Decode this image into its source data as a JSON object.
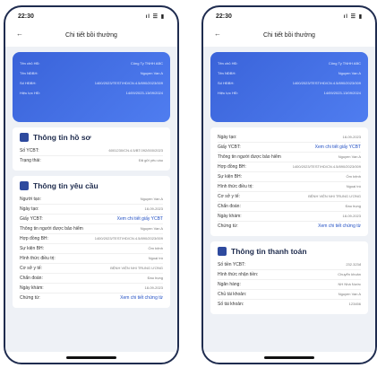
{
  "status": {
    "time": "22:30",
    "icons": "ıl ☰ ▮"
  },
  "appbar": {
    "title": "Chi tiết bồi thường"
  },
  "hero": [
    {
      "label": "Tên chủ HĐ:",
      "value": "Công Ty TNHH ABC"
    },
    {
      "label": "Tên NĐBH:",
      "value": "Nguyen Van A"
    },
    {
      "label": "Số HĐBH:",
      "value": "1400/2023/TEST/HD/CN.4.5/890/2023/009"
    },
    {
      "label": "Hiệu lực HĐ:",
      "value": "14/09/2023-13/09/2024"
    }
  ],
  "left": {
    "ho_so": {
      "title": "Thông tin hồ sơ",
      "rows": [
        {
          "label": "Số YCBT:",
          "value": "6001230/CN.4.5/BT.092/000/2023"
        },
        {
          "label": "Trạng thái:",
          "value": "Đã gửi yêu cầu"
        }
      ]
    },
    "yeu_cau": {
      "title": "Thông tin yêu cầu",
      "rows": [
        {
          "label": "Người tạo:",
          "value": "Nguyen Van A"
        },
        {
          "label": "Ngày tạo:",
          "value": "18-09-2023"
        },
        {
          "label": "Giấy YCBT:",
          "value": "Xem chi tiết giấy YCBT",
          "link": true
        },
        {
          "label": "Thông tin người được bảo hiểm",
          "value": "Nguyen Van A"
        },
        {
          "label": "Hợp đồng BH:",
          "value": "1400/2023/TEST/HD/CN.4.5/890/2023/009"
        },
        {
          "label": "Sự kiện BH:",
          "value": "Ốm bệnh"
        },
        {
          "label": "Hình thức điều trị:",
          "value": "Ngoại trú"
        },
        {
          "label": "Cơ sở y tế:",
          "value": "BỆNH VIỆN NHI TRUNG ƯƠNG"
        },
        {
          "label": "Chẩn đoán:",
          "value": "Đau bụng"
        },
        {
          "label": "Ngày khám:",
          "value": "18-09-2023"
        },
        {
          "label": "Chứng từ:",
          "value": "Xem chi tiết chứng từ",
          "link": true
        }
      ]
    }
  },
  "right": {
    "yeu_cau_rows": [
      {
        "label": "Ngày tạo:",
        "value": "18-09-2023"
      },
      {
        "label": "Giấy YCBT:",
        "value": "Xem chi tiết giấy YCBT",
        "link": true
      },
      {
        "label": "Thông tin người được bảo hiểm",
        "value": "Nguyen Van A"
      },
      {
        "label": "Hợp đồng BH:",
        "value": "1400/2023/TEST/HD/CN.4.5/890/2023/009"
      },
      {
        "label": "Sự kiện BH:",
        "value": "Ốm bệnh"
      },
      {
        "label": "Hình thức điều trị:",
        "value": "Ngoại trú"
      },
      {
        "label": "Cơ sở y tế:",
        "value": "BỆNH VIỆN NHI TRUNG ƯƠNG"
      },
      {
        "label": "Chẩn đoán:",
        "value": "Đau bụng"
      },
      {
        "label": "Ngày khám:",
        "value": "18-09-2023"
      },
      {
        "label": "Chứng từ:",
        "value": "Xem chi tiết chứng từ",
        "link": true
      }
    ],
    "thanh_toan": {
      "title": "Thông tin thanh toán",
      "rows": [
        {
          "label": "Số tiền YCBT:",
          "value": "232.323đ"
        },
        {
          "label": "Hình thức nhận tiền:",
          "value": "Chuyển khoản"
        },
        {
          "label": "Ngân hàng:",
          "value": "NH Nhà Nước"
        },
        {
          "label": "Chủ tài khoản:",
          "value": "Nguyen Van A"
        },
        {
          "label": "Số tài khoản:",
          "value": "123456"
        }
      ]
    }
  },
  "colors": {
    "accent": "#2250c4",
    "hero": "#3a63d9",
    "screen_bg": "#eef1f6",
    "title": "#1e2b4d"
  }
}
